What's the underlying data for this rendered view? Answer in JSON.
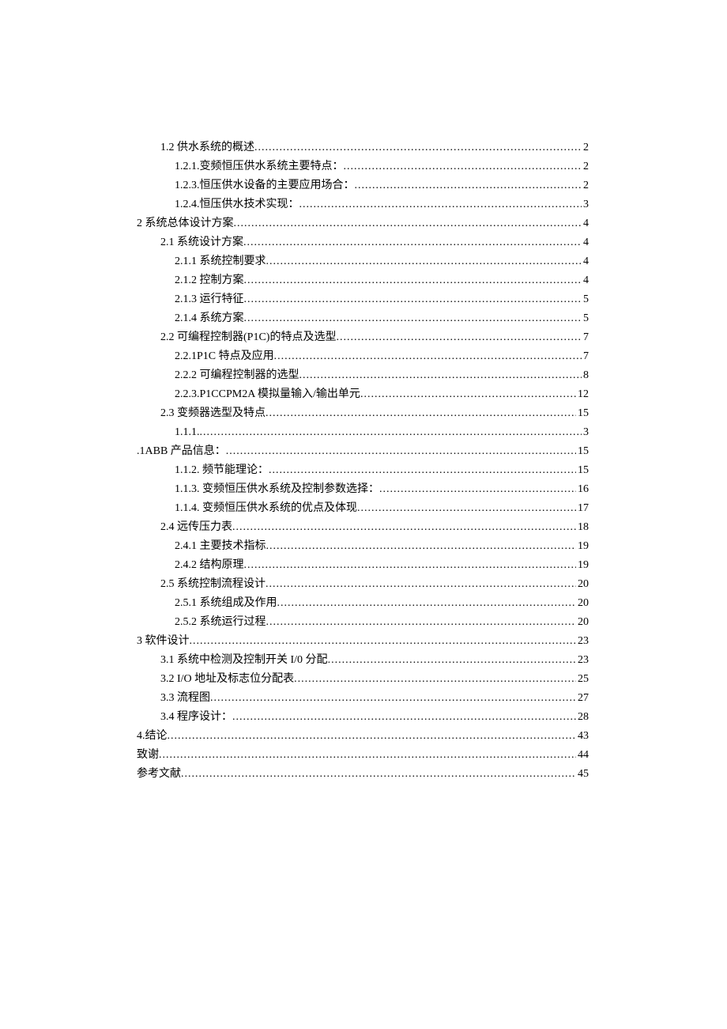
{
  "toc": [
    {
      "indent": 1,
      "label": "1.2 供水系统的概述 ",
      "page": "2"
    },
    {
      "indent": 2,
      "label": "1.2.1.变频恒压供水系统主要特点：  ",
      "page": "2"
    },
    {
      "indent": 2,
      "label": "1.2.3.恒压供水设备的主要应用场合：  ",
      "page": "2"
    },
    {
      "indent": 2,
      "label": "1.2.4.恒压供水技术实现：  ",
      "page": "3"
    },
    {
      "indent": 0,
      "label": "2 系统总体设计方案",
      "page": "4"
    },
    {
      "indent": 1,
      "label": "2.1 系统设计方案 ",
      "page": "4"
    },
    {
      "indent": 2,
      "label": "2.1.1 系统控制要求",
      "page": "4"
    },
    {
      "indent": 2,
      "label": "2.1.2 控制方案",
      "page": "4"
    },
    {
      "indent": 2,
      "label": "2.1.3 运行特征",
      "page": "5"
    },
    {
      "indent": 2,
      "label": "2.1.4 系统方案",
      "page": "5"
    },
    {
      "indent": 1,
      "label": "2.2 可编程控制器(P1C)的特点及选型",
      "page": "7"
    },
    {
      "indent": 2,
      "label": "2.2.1P1C 特点及应用",
      "page": "7"
    },
    {
      "indent": 2,
      "label": "2.2.2 可编程控制器的选型",
      "page": "8"
    },
    {
      "indent": 2,
      "label": "2.2.3.P1CCPM2A 模拟量输入/输出单元",
      "page": "12"
    },
    {
      "indent": 1,
      "label": "2.3 变频器选型及特点 ",
      "page": "15"
    },
    {
      "indent": 2,
      "label": "1.1.1.",
      "page": "3"
    },
    {
      "indent": 0,
      "label": ".1ABB 产品信息：  ",
      "page": "15"
    },
    {
      "indent": 2,
      "label": "1.1.2.    频节能理论：  ",
      "page": "15"
    },
    {
      "indent": 2,
      "label": "1.1.3.   变频恒压供水系统及控制参数选择：  ",
      "page": "16"
    },
    {
      "indent": 2,
      "label": "1.1.4.   变频恒压供水系统的优点及体现  ",
      "page": "17"
    },
    {
      "indent": 1,
      "label": "2.4 远传压力表 ",
      "page": "18"
    },
    {
      "indent": 2,
      "label": "2.4.1 主要技术指标",
      "page": "19"
    },
    {
      "indent": 2,
      "label": "2.4.2 结构原理",
      "page": "19"
    },
    {
      "indent": 1,
      "label": "2.5 系统控制流程设计 ",
      "page": "20"
    },
    {
      "indent": 2,
      "label": "2.5.1 系统组成及作用",
      "page": "20"
    },
    {
      "indent": 2,
      "label": "2.5.2 系统运行过程",
      "page": "20"
    },
    {
      "indent": 0,
      "label": "3 软件设计 ",
      "page": "23"
    },
    {
      "indent": 1,
      "label": "3.1   系统中检测及控制开关 I/0 分配 ",
      "page": "23"
    },
    {
      "indent": 1,
      "label": "3.2   I/O 地址及标志位分配表",
      "page": "25"
    },
    {
      "indent": 1,
      "label": "3.3   流程图 ",
      "page": "27"
    },
    {
      "indent": 1,
      "label": "3.4   程序设计：  ",
      "page": "28"
    },
    {
      "indent": 0,
      "label": "4.结论",
      "page": "43"
    },
    {
      "indent": 0,
      "label": "致谢 ",
      "page": "44"
    },
    {
      "indent": 0,
      "label": "参考文献 ",
      "page": "45"
    }
  ]
}
